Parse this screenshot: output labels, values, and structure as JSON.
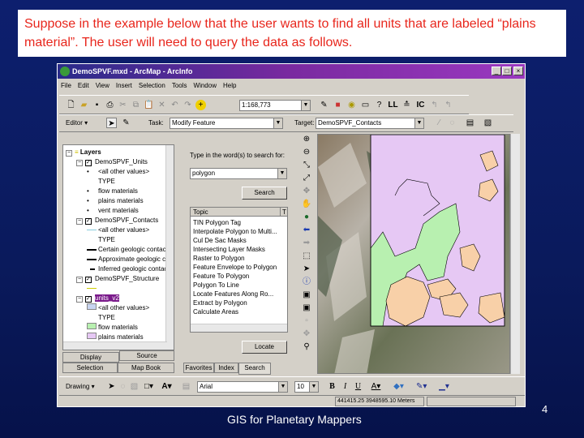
{
  "caption": "Suppose in the example below that the user wants to find all units that are labeled “plains material”. The user will need to query the data as follows.",
  "window": {
    "title": "DemoSPVF.mxd - ArcMap - ArcInfo",
    "min": "_",
    "max": "□",
    "close": "×"
  },
  "menu": [
    "File",
    "Edit",
    "View",
    "Insert",
    "Selection",
    "Tools",
    "Window",
    "Help"
  ],
  "toolbar": {
    "scale": "1:168,773",
    "editor_label": "Editor ▾",
    "task_label": "Task:",
    "task_value": "Modify Feature",
    "target_label": "Target:",
    "target_value": "DemoSPVF_Contacts"
  },
  "toc": {
    "items": [
      {
        "label": "Layers",
        "indent": 0,
        "kind": "group"
      },
      {
        "label": "DemoSPVF_Units",
        "indent": 1,
        "kind": "layer"
      },
      {
        "label": "<all other values>",
        "indent": 2,
        "kind": "dot"
      },
      {
        "label": "TYPE",
        "indent": 2,
        "kind": "none"
      },
      {
        "label": "flow materials",
        "indent": 2,
        "kind": "dot"
      },
      {
        "label": "plains materials",
        "indent": 2,
        "kind": "dot"
      },
      {
        "label": "vent materials",
        "indent": 2,
        "kind": "dot"
      },
      {
        "label": "DemoSPVF_Contacts",
        "indent": 1,
        "kind": "layer"
      },
      {
        "label": "<all other values>",
        "indent": 2,
        "kind": "line-cyan"
      },
      {
        "label": "TYPE",
        "indent": 2,
        "kind": "none"
      },
      {
        "label": "Certain geologic contact",
        "indent": 2,
        "kind": "line"
      },
      {
        "label": "Approximate geologic contact",
        "indent": 2,
        "kind": "line"
      },
      {
        "label": "Inferred geologic contact",
        "indent": 2,
        "kind": "line-short"
      },
      {
        "label": "DemoSPVF_Structure",
        "indent": 1,
        "kind": "layer"
      },
      {
        "label": "",
        "indent": 2,
        "kind": "line-yellow"
      },
      {
        "label": "units_v2",
        "indent": 1,
        "kind": "layer-selected"
      },
      {
        "label": "<all other values>",
        "indent": 2,
        "kind": "swatch-blue"
      },
      {
        "label": "TYPE",
        "indent": 2,
        "kind": "none"
      },
      {
        "label": "flow materials",
        "indent": 2,
        "kind": "swatch-green"
      },
      {
        "label": "plains materials",
        "indent": 2,
        "kind": "swatch-lavender"
      }
    ],
    "tabs": [
      "Display",
      "Source",
      "Selection",
      "Map Book"
    ]
  },
  "search": {
    "prompt": "Type in the word(s) to search for:",
    "query": "polygon",
    "search_button": "Search",
    "col_topic": "Topic",
    "col_type": "T",
    "results": [
      "TIN Polygon Tag",
      "Interpolate Polygon to Multi...",
      "Cul De Sac Masks",
      "Intersecting Layer Masks",
      "Raster to Polygon",
      "Feature Envelope to Polygon",
      "Feature To Polygon",
      "Polygon To Line",
      "Locate Features Along Ro...",
      "Extract by Polygon",
      "Calculate Areas"
    ],
    "locate_button": "Locate",
    "tabs": [
      "Favorites",
      "Index",
      "Search"
    ]
  },
  "drawing": {
    "label": "Drawing ▾",
    "font": "Arial",
    "size": "10",
    "bold": "B",
    "italic": "I",
    "underline": "U"
  },
  "status": {
    "coords": "441415.25 3948595.10 Meters"
  },
  "footer": "GIS for Planetary Mappers",
  "page_number": "4",
  "colors": {
    "caption_text": "#e8261c",
    "plains": "#e6c8f4",
    "flow": "#b8f0b0",
    "beige": "#f8d0a8",
    "title_bar": "#7a2aa0"
  }
}
